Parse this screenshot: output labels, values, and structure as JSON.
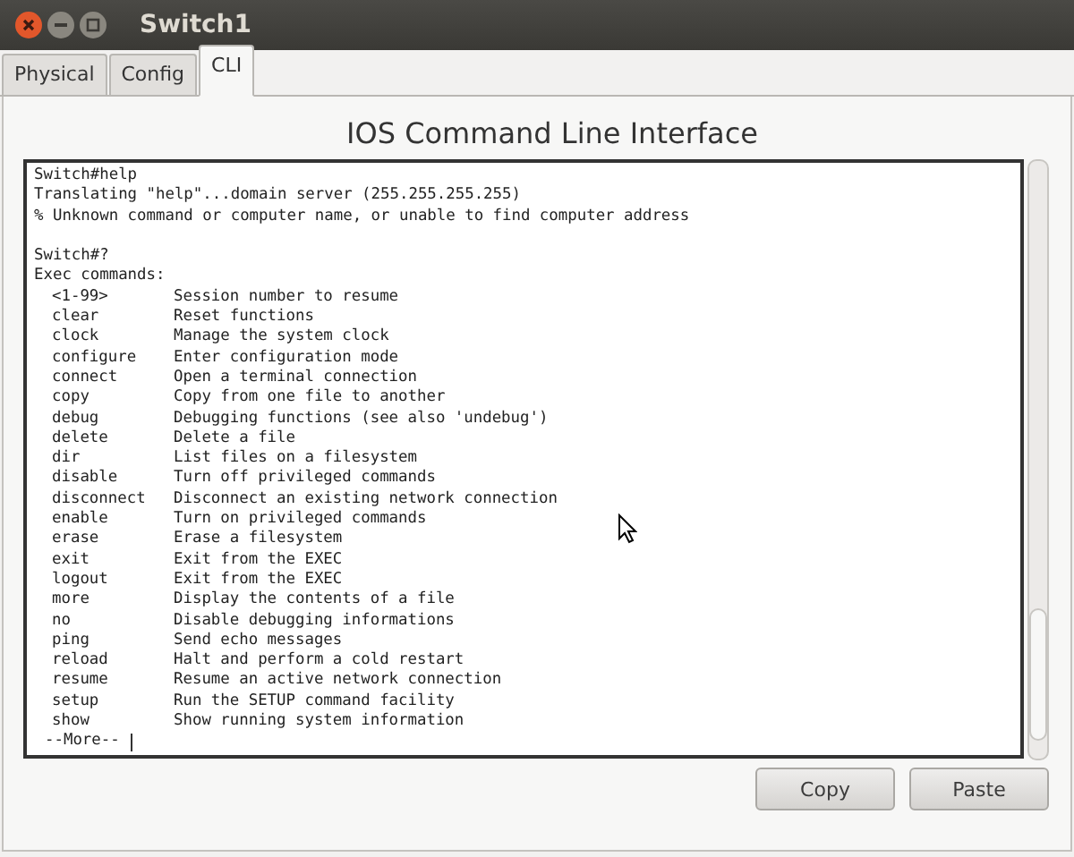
{
  "window": {
    "title": "Switch1"
  },
  "tabs": [
    {
      "label": "Physical",
      "selected": false
    },
    {
      "label": "Config",
      "selected": false
    },
    {
      "label": "CLI",
      "selected": true
    }
  ],
  "heading": "IOS Command Line Interface",
  "terminal": {
    "blocks": [
      [
        "Switch#help",
        "Translating \"help\"...domain server (255.255.255.255)",
        "% Unknown command or computer name, or unable to find computer address"
      ],
      [
        "Switch#?",
        "Exec commands:"
      ]
    ],
    "commands": [
      {
        "name": "<1-99>",
        "description": "Session number to resume"
      },
      {
        "name": "clear",
        "description": "Reset functions"
      },
      {
        "name": "clock",
        "description": "Manage the system clock"
      },
      {
        "name": "configure",
        "description": "Enter configuration mode"
      },
      {
        "name": "connect",
        "description": "Open a terminal connection"
      },
      {
        "name": "copy",
        "description": "Copy from one file to another"
      },
      {
        "name": "debug",
        "description": "Debugging functions (see also 'undebug')"
      },
      {
        "name": "delete",
        "description": "Delete a file"
      },
      {
        "name": "dir",
        "description": "List files on a filesystem"
      },
      {
        "name": "disable",
        "description": "Turn off privileged commands"
      },
      {
        "name": "disconnect",
        "description": "Disconnect an existing network connection"
      },
      {
        "name": "enable",
        "description": "Turn on privileged commands"
      },
      {
        "name": "erase",
        "description": "Erase a filesystem"
      },
      {
        "name": "exit",
        "description": "Exit from the EXEC"
      },
      {
        "name": "logout",
        "description": "Exit from the EXEC"
      },
      {
        "name": "more",
        "description": "Display the contents of a file"
      },
      {
        "name": "no",
        "description": "Disable debugging informations"
      },
      {
        "name": "ping",
        "description": "Send echo messages"
      },
      {
        "name": "reload",
        "description": "Halt and perform a cold restart"
      },
      {
        "name": "resume",
        "description": "Resume an active network connection"
      },
      {
        "name": "setup",
        "description": "Run the SETUP command facility"
      },
      {
        "name": "show",
        "description": "Show running system information"
      }
    ],
    "prompt": "--More--"
  },
  "buttons": [
    "Copy",
    "Paste"
  ]
}
